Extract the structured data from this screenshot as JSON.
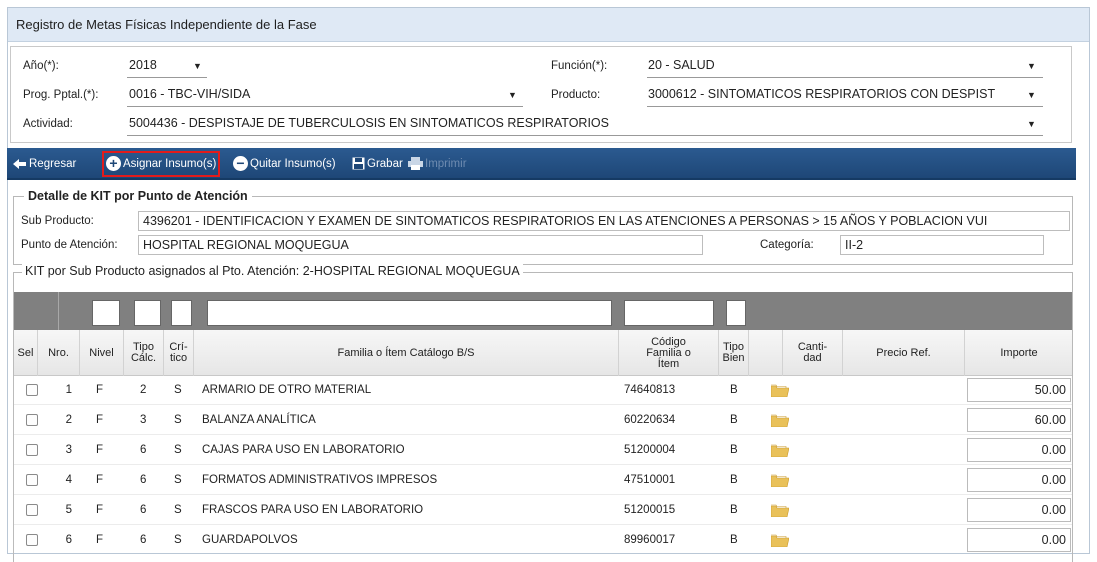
{
  "window_title": "Registro de Metas Físicas Independiente de la Fase",
  "form": {
    "anio": {
      "label": "Año(*):",
      "value": "2018"
    },
    "funcion": {
      "label": "Función(*):",
      "value": "20 - SALUD"
    },
    "prog": {
      "label": "Prog. Pptal.(*):",
      "value": "0016 - TBC-VIH/SIDA"
    },
    "producto": {
      "label": "Producto:",
      "value": "3000612 - SINTOMATICOS RESPIRATORIOS CON DESPIST"
    },
    "actividad": {
      "label": "Actividad:",
      "value": "5004436 - DESPISTAJE DE TUBERCULOSIS EN SINTOMATICOS RESPIRATORIOS"
    }
  },
  "toolbar": {
    "regresar": "Regresar",
    "asignar": "Asignar Insumo(s)",
    "quitar": "Quitar Insumo(s)",
    "grabar": "Grabar",
    "imprimir": "Imprimir"
  },
  "detalle": {
    "legend": "Detalle de KIT por Punto de Atención",
    "subproducto_label": "Sub Producto:",
    "subproducto_value": "4396201 - IDENTIFICACION Y EXAMEN DE SINTOMATICOS RESPIRATORIOS EN LAS ATENCIONES A PERSONAS > 15 AÑOS Y POBLACION VUI",
    "punto_label": "Punto de Atención:",
    "punto_value": "HOSPITAL REGIONAL MOQUEGUA",
    "categoria_label": "Categoría:",
    "categoria_value": "II-2"
  },
  "kit": {
    "legend": "KIT por Sub Producto asignados al Pto. Atención: 2-HOSPITAL REGIONAL MOQUEGUA"
  },
  "columns": {
    "sel": "Sel",
    "nro": "Nro.",
    "nivel": "Nivel",
    "tipo_calc": "Tipo Cálc.",
    "critico": "Crí- tico",
    "familia": "Familia o Ítem Catálogo B/S",
    "codigo": "Código Familia o Ítem",
    "tipo_bien": "Tipo Bien",
    "cantidad": "Canti- dad",
    "precio": "Precio Ref.",
    "importe": "Importe"
  },
  "rows": [
    {
      "nro": "1",
      "nivel": "F",
      "tipo": "2",
      "critico": "S",
      "familia": "ARMARIO DE OTRO MATERIAL",
      "codigo": "74640813",
      "bien": "B",
      "importe": "50.00"
    },
    {
      "nro": "2",
      "nivel": "F",
      "tipo": "3",
      "critico": "S",
      "familia": "BALANZA ANALÍTICA",
      "codigo": "60220634",
      "bien": "B",
      "importe": "60.00"
    },
    {
      "nro": "3",
      "nivel": "F",
      "tipo": "6",
      "critico": "S",
      "familia": "CAJAS PARA USO EN LABORATORIO",
      "codigo": "51200004",
      "bien": "B",
      "importe": "0.00"
    },
    {
      "nro": "4",
      "nivel": "F",
      "tipo": "6",
      "critico": "S",
      "familia": "FORMATOS ADMINISTRATIVOS IMPRESOS",
      "codigo": "47510001",
      "bien": "B",
      "importe": "0.00"
    },
    {
      "nro": "5",
      "nivel": "F",
      "tipo": "6",
      "critico": "S",
      "familia": "FRASCOS PARA USO EN LABORATORIO",
      "codigo": "51200015",
      "bien": "B",
      "importe": "0.00"
    },
    {
      "nro": "6",
      "nivel": "F",
      "tipo": "6",
      "critico": "S",
      "familia": "GUARDAPOLVOS",
      "codigo": "89960017",
      "bien": "B",
      "importe": "0.00"
    }
  ],
  "colors": {
    "toolbar": "#1e4777",
    "highlight": "#e21b1b",
    "folder": "#e9c15a"
  }
}
